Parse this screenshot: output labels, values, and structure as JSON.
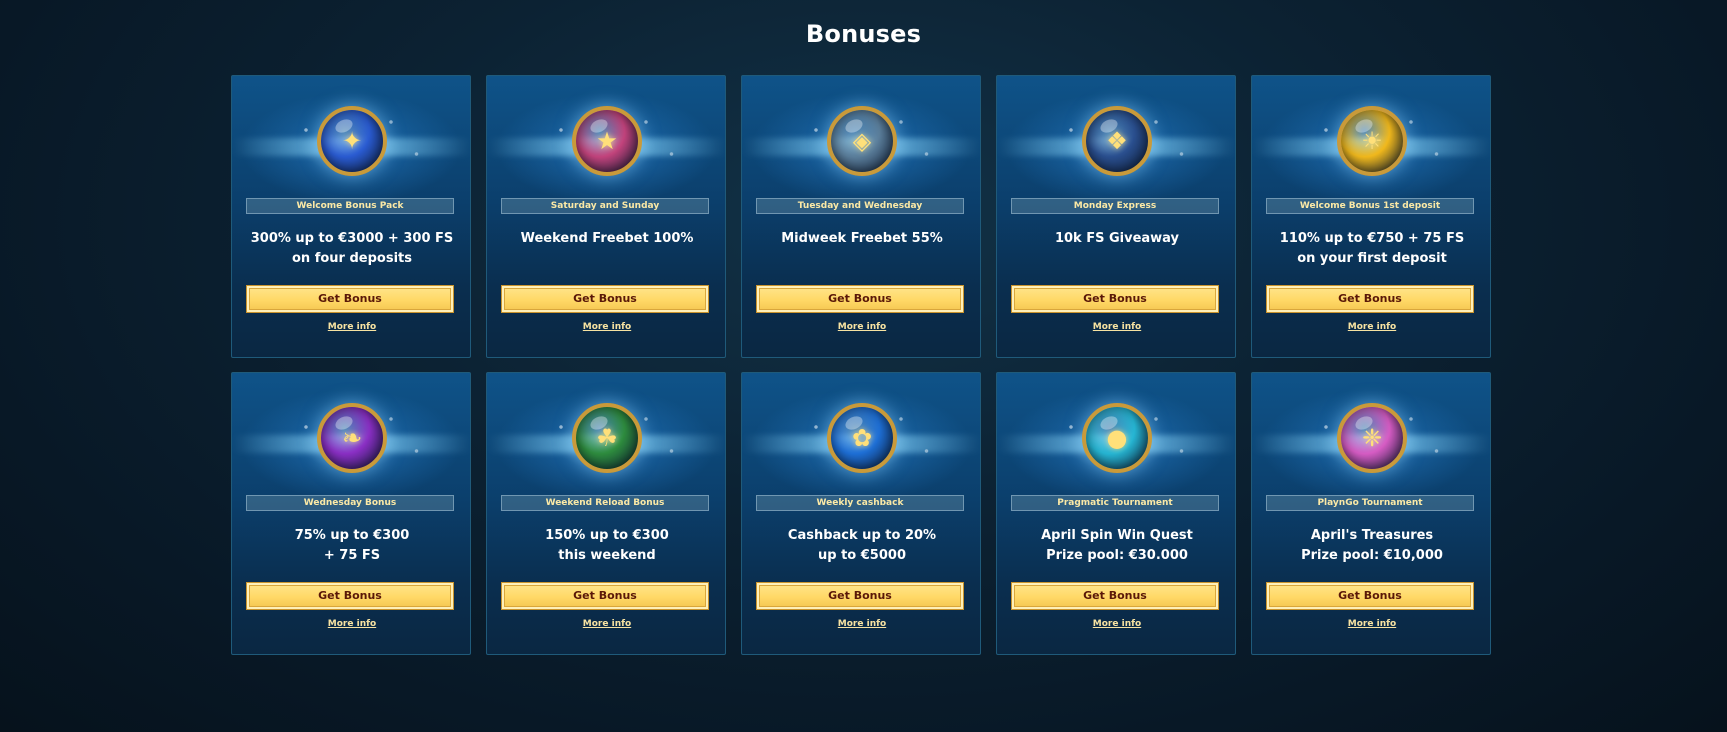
{
  "page": {
    "title": "Bonuses"
  },
  "bonuses": [
    {
      "tag": "Welcome Bonus Pack",
      "line1": "300% up to €3000 + 300 FS",
      "line2": "on four deposits",
      "cta": "Get Bonus",
      "more": "More info",
      "icon": "blue-gold-orb-icon",
      "color": "#2a5bd1"
    },
    {
      "tag": "Saturday and Sunday",
      "line1": "Weekend Freebet 100%",
      "line2": "",
      "cta": "Get Bonus",
      "more": "More info",
      "icon": "trophy-orb-icon",
      "color": "#c2437c"
    },
    {
      "tag": "Tuesday and Wednesday",
      "line1": "Midweek Freebet 55%",
      "line2": "",
      "cta": "Get Bonus",
      "more": "More info",
      "icon": "stone-ball-orb-icon",
      "color": "#5b7e9b"
    },
    {
      "tag": "Monday Express",
      "line1": "10k FS Giveaway",
      "line2": "",
      "cta": "Get Bonus",
      "more": "More info",
      "icon": "eagle-shield-icon",
      "color": "#2a4f8f"
    },
    {
      "tag": "Welcome Bonus 1st deposit",
      "line1": "110% up to €750 + 75 FS",
      "line2": "on your first deposit",
      "cta": "Get Bonus",
      "more": "More info",
      "icon": "sun-orb-icon",
      "color": "#f0b81c"
    },
    {
      "tag": "Wednesday Bonus",
      "line1": "75% up to €300",
      "line2": "+ 75 FS",
      "cta": "Get Bonus",
      "more": "More info",
      "icon": "purple-green-orb-icon",
      "color": "#8a2fc4"
    },
    {
      "tag": "Weekend Reload Bonus",
      "line1": "150% up to €300",
      "line2": "this weekend",
      "cta": "Get Bonus",
      "more": "More info",
      "icon": "leaf-orb-icon",
      "color": "#2e8c3e"
    },
    {
      "tag": "Weekly cashback",
      "line1": "Cashback up to 20%",
      "line2": "up to €5000",
      "cta": "Get Bonus",
      "more": "More info",
      "icon": "blue-rose-orb-icon",
      "color": "#1e6fd6"
    },
    {
      "tag": "Pragmatic Tournament",
      "line1": "April Spin Win Quest",
      "line2": "Prize pool: €30.000",
      "cta": "Get Bonus",
      "more": "More info",
      "icon": "cyan-orb-icon",
      "color": "#26b6d4"
    },
    {
      "tag": "PlaynGo Tournament",
      "line1": "April's Treasures",
      "line2": "Prize pool: €10,000",
      "cta": "Get Bonus",
      "more": "More info",
      "icon": "pink-gold-orb-icon",
      "color": "#d65cc4"
    }
  ]
}
